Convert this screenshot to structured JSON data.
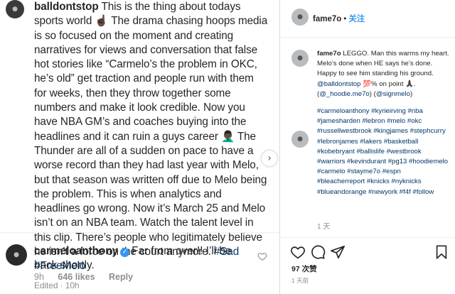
{
  "post": {
    "username": "balldontstop",
    "caption_parts": [
      {
        "text": "This is the thing about todays sports world ",
        "kind": "text"
      },
      {
        "text": "☝🏿",
        "kind": "text"
      },
      {
        "text": " The drama chasing hoops media is so focused on the moment and creating narratives for views and conversation that false hot stories like “Carmelo’s the problem in OKC, he’s old” get traction and people run with them for weeks, then they throw together some numbers and make it look credible. Now you have NBA GM’s and coaches buying into the headlines and it can ruin a guys career ",
        "kind": "text"
      },
      {
        "text": "🤦🏿‍♂️",
        "kind": "text"
      },
      {
        "text": " The Thunder are all of a sudden on pace to have a worse record than they had last year with Melo, but that season was written off due to Melo being the problem. This is when analytics and headlines go wrong. Now it’s March 25 and Melo isn’t on an NBA team. Watch the talent level in this clip. There’s people who legitimately believe he isn’t a force on the court anymore. ",
        "kind": "text"
      },
      {
        "text": "#Sad",
        "kind": "tag"
      },
      {
        "text": " ",
        "kind": "text"
      },
      {
        "text": "#FreeMelo",
        "kind": "tag"
      }
    ],
    "edited_label": "Edited · 10h"
  },
  "reply": {
    "username": "carmeloanthony",
    "verified_glyph": "✓",
    "text": "Far from over!! I’ll be back shortly.",
    "time": "9h",
    "likes": "646 likes",
    "reply_label": "Reply"
  },
  "right": {
    "username": "fame7o",
    "separator": "•",
    "follow_label": "关注",
    "caption": {
      "username": "fame7o",
      "text_1": "LEGGO. Man this warms my heart. Melo’s done when HE says he’s done. Happy to see him standing his ground. ",
      "mention_1": "@balldontstop",
      "text_2": " 💯% on point 🙏🏿. (",
      "mention_2": "@_hoodie.me7o",
      "text_3": ") (",
      "mention_3": "@signmelo",
      "text_4": ")"
    },
    "hashtags": "#carmeloanthony #kyrieirving #nba #jamesharden #lebron #melo #okc #russellwestbrook #kingjames #stephcurry #lebronjames #lakers #basketball #kobebryant #ballislife #westbrook #warriors #kevindurant #pg13 #hoodiemelo #carmelo #stayme7o #espn #bleacherreport #knicks #nyknicks #blueandorange #newyork #f4f #follow",
    "comment_time": "1 天",
    "likes_count": "97 次赞",
    "post_time": "1 天前"
  },
  "icons": {
    "next": "chevron-right-icon",
    "heart": "heart-icon",
    "comment": "comment-icon",
    "share": "share-icon",
    "bookmark": "bookmark-icon"
  }
}
